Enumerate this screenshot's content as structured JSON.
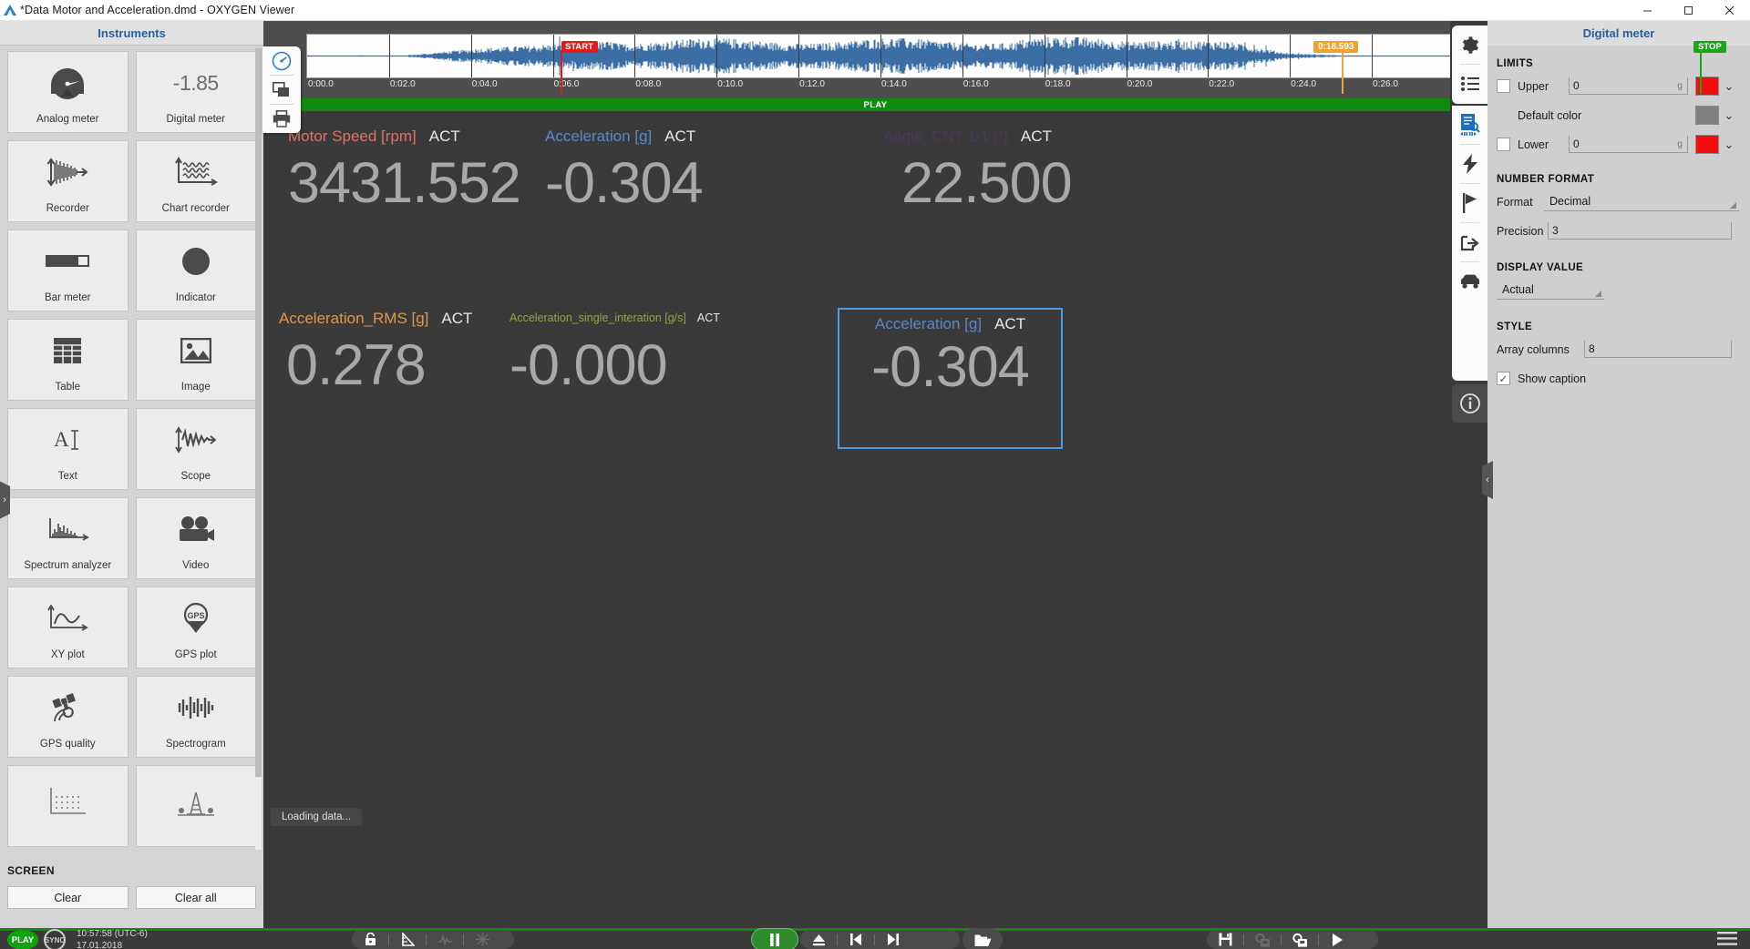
{
  "window": {
    "title": "*Data Motor and Acceleration.dmd - OXYGEN Viewer",
    "minimize": "—",
    "maximize": "❐",
    "close": "✕"
  },
  "instruments_panel": {
    "header": "Instruments",
    "items": [
      {
        "label": "Analog meter",
        "icon": "analog-gauge-icon"
      },
      {
        "label": "Digital meter",
        "icon": "digital-number-icon",
        "sample_value": "-1.85"
      },
      {
        "label": "Recorder",
        "icon": "recorder-waveform-icon"
      },
      {
        "label": "Chart recorder",
        "icon": "chart-recorder-icon"
      },
      {
        "label": "Bar meter",
        "icon": "bar-meter-icon"
      },
      {
        "label": "Indicator",
        "icon": "indicator-circle-icon"
      },
      {
        "label": "Table",
        "icon": "table-grid-icon"
      },
      {
        "label": "Image",
        "icon": "image-picture-icon"
      },
      {
        "label": "Text",
        "icon": "text-cursor-icon"
      },
      {
        "label": "Scope",
        "icon": "scope-waveform-icon"
      },
      {
        "label": "Spectrum analyzer",
        "icon": "spectrum-analyzer-icon"
      },
      {
        "label": "Video",
        "icon": "video-camera-icon"
      },
      {
        "label": "XY plot",
        "icon": "xy-plot-icon"
      },
      {
        "label": "GPS plot",
        "icon": "gps-pin-icon",
        "glyph_text": "GPS"
      },
      {
        "label": "GPS quality",
        "icon": "gps-satellite-icon"
      },
      {
        "label": "Spectrogram",
        "icon": "spectrogram-bars-icon"
      },
      {
        "label": "",
        "icon": "grid-matrix-icon"
      },
      {
        "label": "",
        "icon": "rig-tower-icon"
      }
    ],
    "screen_section": {
      "title": "SCREEN",
      "clear": "Clear",
      "clear_all": "Clear all"
    },
    "collapse_handle": "›"
  },
  "navigator": {
    "start_badge": "START",
    "stop_badge": "STOP",
    "cursor_time": "0:18.593",
    "play_band": "PLAY",
    "time_ticks": [
      "0:00.0",
      "0:02.0",
      "0:04.0",
      "0:06.0",
      "0:08.0",
      "0:10.0",
      "0:12.0",
      "0:14.0",
      "0:16.0",
      "0:18.0",
      "0:20.0",
      "0:22.0",
      "0:24.0",
      "0:26.0"
    ],
    "tools": [
      {
        "icon": "speedometer-icon"
      },
      {
        "icon": "duplicate-window-icon"
      },
      {
        "icon": "printer-icon"
      }
    ],
    "waveform_color": "#3b6ea5"
  },
  "meters": [
    {
      "name": "Motor Speed [rpm]",
      "mode": "ACT",
      "value": "3431.552",
      "color": "#d9736a",
      "selected": false
    },
    {
      "name": "Acceleration [g]",
      "mode": "ACT",
      "value": "-0.304",
      "color": "#5b87c4",
      "selected": false
    },
    {
      "name": "Angle_CNT 1/1 [°]",
      "mode": "ACT",
      "value": "22.500",
      "color": "#4b3a5c",
      "selected": false
    },
    {
      "name": "Acceleration_RMS [g]",
      "mode": "ACT",
      "value": "0.278",
      "color": "#e0954a",
      "selected": false
    },
    {
      "name": "Acceleration_single_interation [g/s]",
      "mode": "ACT",
      "value": "-0.000",
      "color": "#8aa84a",
      "selected": false
    },
    {
      "name": "Acceleration [g]",
      "mode": "ACT",
      "value": "-0.304",
      "color": "#5b87c4",
      "selected": true
    }
  ],
  "loading_text": "Loading data...",
  "rail_icons": [
    {
      "icon": "gear-icon",
      "active": false
    },
    {
      "icon": "list-icon",
      "active": false
    },
    {
      "icon": "channel-list-icon",
      "active": true
    },
    {
      "icon": "lightning-icon",
      "active": false
    },
    {
      "icon": "flag-icon",
      "active": false
    },
    {
      "icon": "export-share-icon",
      "active": false
    },
    {
      "icon": "car-icon",
      "active": false
    },
    {
      "icon": "info-icon",
      "active": false
    }
  ],
  "properties": {
    "title": "Digital meter",
    "limits": {
      "section": "LIMITS",
      "upper_label": "Upper",
      "upper_value": "0",
      "upper_unit": "g",
      "upper_checked": false,
      "upper_color": "#f40d0d",
      "default_color_label": "Default color",
      "default_color": "#808080",
      "lower_label": "Lower",
      "lower_value": "0",
      "lower_unit": "g",
      "lower_checked": false,
      "lower_color": "#f40d0d",
      "chevron": "⌄"
    },
    "number_format": {
      "section": "NUMBER FORMAT",
      "format_label": "Format",
      "format_value": "Decimal",
      "precision_label": "Precision",
      "precision_value": "3"
    },
    "display_value": {
      "section": "DISPLAY VALUE",
      "value": "Actual"
    },
    "style": {
      "section": "STYLE",
      "array_columns_label": "Array columns",
      "array_columns_value": "8",
      "show_caption_label": "Show caption",
      "show_caption_checked": true
    },
    "collapse_handle": "‹"
  },
  "statusbar": {
    "play": "PLAY",
    "sync": "SYNC",
    "time": "10:57:58 (UTC-6)",
    "date": "17.01.2018",
    "left_tools": [
      {
        "icon": "lock-icon",
        "enabled": true
      },
      {
        "icon": "ruler-triangle-icon",
        "enabled": true
      },
      {
        "icon": "signal-icon",
        "enabled": false
      },
      {
        "icon": "snowflake-icon",
        "enabled": false
      }
    ],
    "transport": [
      {
        "icon": "pause-icon"
      },
      {
        "icon": "eject-icon"
      },
      {
        "icon": "skip-previous-icon"
      },
      {
        "icon": "skip-next-icon"
      },
      {
        "icon": "folder-open-icon"
      }
    ],
    "right_tools": [
      {
        "icon": "save-icon",
        "enabled": true
      },
      {
        "icon": "settings-save-icon",
        "enabled": false
      },
      {
        "icon": "settings-store-icon",
        "enabled": true
      },
      {
        "icon": "play-arrow-icon",
        "enabled": true
      }
    ],
    "menu_icon": "hamburger-menu-icon"
  }
}
